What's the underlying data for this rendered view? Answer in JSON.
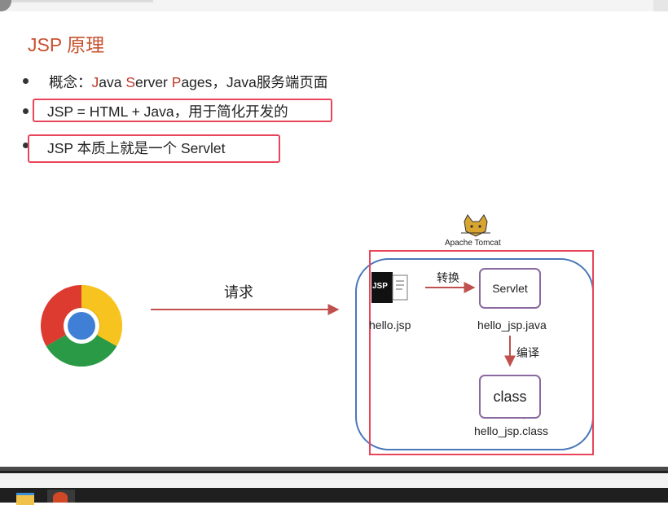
{
  "slide": {
    "title": "JSP 原理",
    "bullets": [
      {
        "parts": [
          "概念：",
          "J",
          "ava ",
          "S",
          "erver ",
          "P",
          "ages，Java服务端页面"
        ]
      },
      {
        "text": "JSP = HTML + Java，用于简化开发的"
      },
      {
        "text": "JSP 本质上就是一个 Servlet"
      }
    ]
  },
  "diagram": {
    "request_label": "请求",
    "tomcat_label": "Apache Tomcat",
    "jsp_icon_text": "JSP",
    "jsp_file_label": "hello.jsp",
    "convert_label": "转换",
    "servlet_box_text": "Servlet",
    "java_file_label": "hello_jsp.java",
    "compile_label": "编译",
    "class_box_text": "class",
    "class_file_label": "hello_jsp.class"
  },
  "colors": {
    "title": "#c8512f",
    "highlight_box": "#e8455a",
    "arrow": "#c0504d",
    "tomcat_container": "#4a78b8",
    "node_border": "#8a6aa0"
  },
  "taskbar": {
    "icons": [
      "file-explorer-icon",
      "powerpoint-icon"
    ]
  }
}
